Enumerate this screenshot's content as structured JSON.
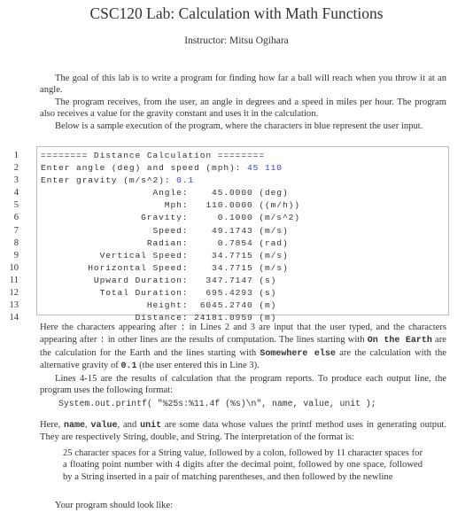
{
  "document": {
    "title": "CSC120 Lab: Calculation with Math Functions",
    "instructor": "Instructor: Mitsu Ogihara"
  },
  "intro": {
    "paragraphs": [
      "The goal of this lab is to write a program for finding how far a ball will reach when you throw it at an angle.",
      "The program receives, from the user, an angle in degrees and a speed in miles per hour. The program also receives a value for the gravity constant and uses it in the calculation.",
      "Below is a sample execution of the program, where the characters in blue represent the user input."
    ]
  },
  "sample_execution": {
    "input_color": "#3a3fd0",
    "lines": [
      {
        "num": "1",
        "text": "======== Distance Calculation ========",
        "input": ""
      },
      {
        "num": "2",
        "text": "Enter angle (deg) and speed (mph): ",
        "input": "45 110"
      },
      {
        "num": "3",
        "text": "Enter gravity (m/s^2): ",
        "input": "0.1"
      },
      {
        "num": "4",
        "text": "                   Angle:    45.0000 (deg)",
        "input": ""
      },
      {
        "num": "5",
        "text": "                     Mph:   110.0000 ((m/h))",
        "input": ""
      },
      {
        "num": "6",
        "text": "                 Gravity:     0.1000 (m/s^2)",
        "input": ""
      },
      {
        "num": "7",
        "text": "                   Speed:    49.1743 (m/s)",
        "input": ""
      },
      {
        "num": "8",
        "text": "                  Radian:     0.7854 (rad)",
        "input": ""
      },
      {
        "num": "9",
        "text": "          Vertical Speed:    34.7715 (m/s)",
        "input": ""
      },
      {
        "num": "10",
        "text": "        Horizontal Speed:    34.7715 (m/s)",
        "input": ""
      },
      {
        "num": "11",
        "text": "         Upward Duration:   347.7147 (s)",
        "input": ""
      },
      {
        "num": "12",
        "text": "          Total Duration:   695.4293 (s)",
        "input": ""
      },
      {
        "num": "13",
        "text": "                  Height:  6045.2740 (m)",
        "input": ""
      },
      {
        "num": "14",
        "text": "                Distance: 24181.0959 (m)",
        "input": ""
      }
    ]
  },
  "explanation": {
    "p1_a": "Here the characters appearing after ",
    "p1_colon1": ":",
    "p1_b": " in Lines 2 and 3 are input that the user typed, and the characters appearing after ",
    "p1_colon2": ":",
    "p1_c": " in other lines are the results of computation. The lines starting with ",
    "p1_code1": "On the Earth",
    "p1_d": " are the calculation for the Earth and the lines starting with ",
    "p1_code2": "Somewhere else",
    "p1_e": " are the calculation with the alternative gravity of ",
    "p1_code3": "0.1",
    "p1_f": " (the user entered this in Line 3).",
    "p2": "Lines 4-15 are the results of calculation that the program reports. To produce each output line, the program uses the following format:"
  },
  "printf_example": "System.out.printf( \"%25s:%11.4f (%s)\\n\", name, value, unit );",
  "format_explanation": {
    "a": "Here, ",
    "code_name": "name",
    "b": ", ",
    "code_value": "value",
    "c": ", and ",
    "code_unit": "unit",
    "d": " are some data whose values the printf method uses in generating output. They are respectively String, double, and String. The interpretation of the format is:"
  },
  "format_quote": "25 character spaces for a String value, followed by a colon, followed by 11 character spaces for a floating point number with 4 digits after the decimal point, followed by one space, followed by a String inserted in a pair of matching parentheses, and then followed by the newline",
  "closing": "Your program should look like:"
}
